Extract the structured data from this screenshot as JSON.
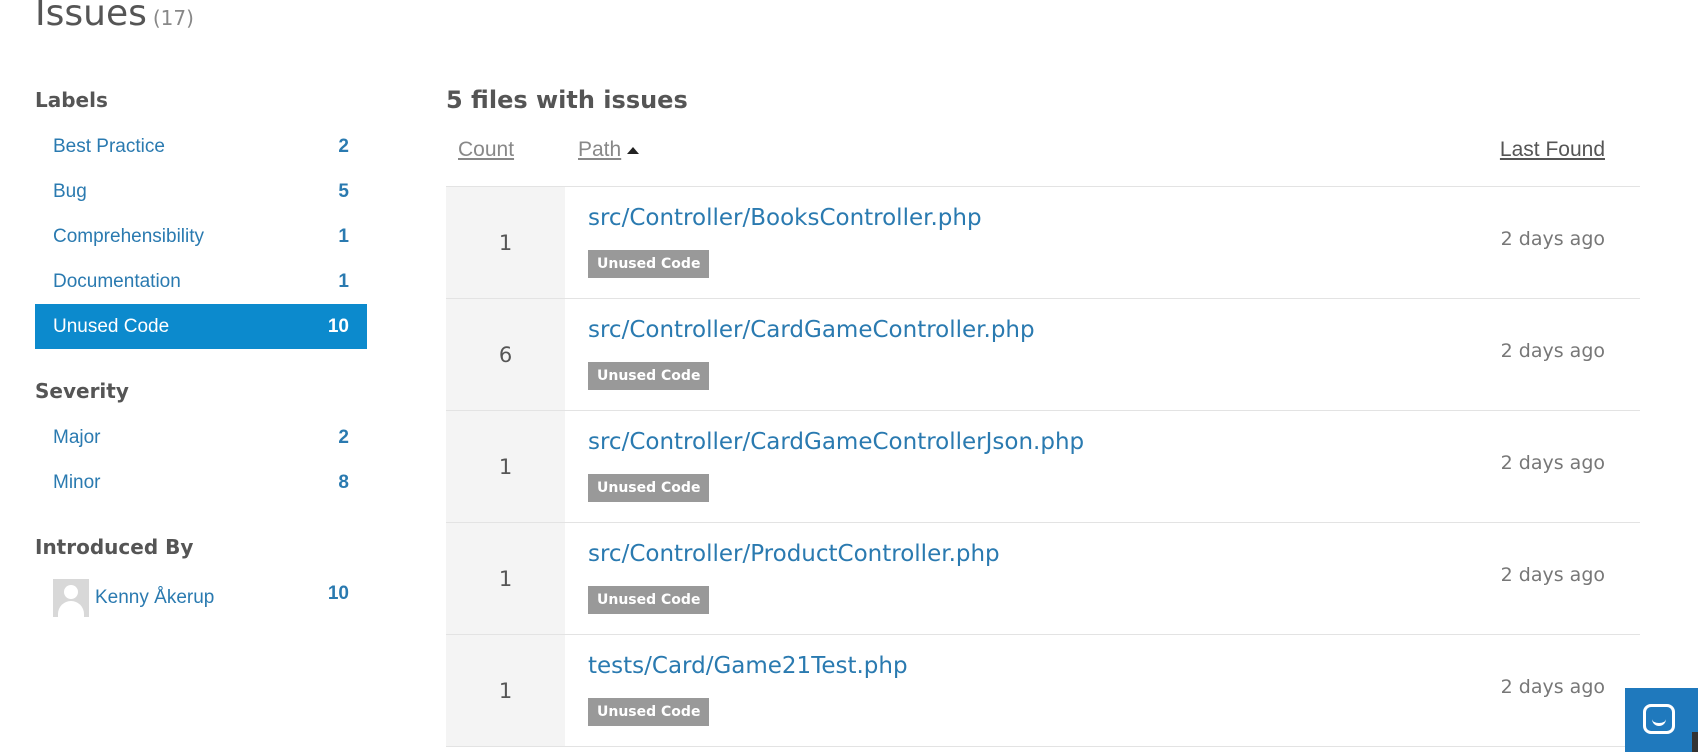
{
  "header": {
    "title": "Issues",
    "count": "(17)"
  },
  "sidebar": {
    "labels_title": "Labels",
    "labels": [
      {
        "name": "Best Practice",
        "count": "2"
      },
      {
        "name": "Bug",
        "count": "5"
      },
      {
        "name": "Comprehensibility",
        "count": "1"
      },
      {
        "name": "Documentation",
        "count": "1"
      },
      {
        "name": "Unused Code",
        "count": "10",
        "active": true
      }
    ],
    "severity_title": "Severity",
    "severity": [
      {
        "name": "Major",
        "count": "2"
      },
      {
        "name": "Minor",
        "count": "8"
      }
    ],
    "introduced_title": "Introduced By",
    "introduced": [
      {
        "name": "Kenny Åkerup",
        "count": "10"
      }
    ]
  },
  "main": {
    "files_title": "5 files with issues",
    "columns": {
      "count": "Count",
      "path": "Path",
      "last_found": "Last Found"
    },
    "rows": [
      {
        "count": "1",
        "path": "src/Controller/BooksController.php",
        "badge": "Unused Code",
        "found": "2 days ago"
      },
      {
        "count": "6",
        "path": "src/Controller/CardGameController.php",
        "badge": "Unused Code",
        "found": "2 days ago"
      },
      {
        "count": "1",
        "path": "src/Controller/CardGameControllerJson.php",
        "badge": "Unused Code",
        "found": "2 days ago"
      },
      {
        "count": "1",
        "path": "src/Controller/ProductController.php",
        "badge": "Unused Code",
        "found": "2 days ago"
      },
      {
        "count": "1",
        "path": "tests/Card/Game21Test.php",
        "badge": "Unused Code",
        "found": "2 days ago"
      }
    ]
  },
  "colors": {
    "accent": "#0c8acd",
    "link": "#2a7ab0",
    "badge": "#999999",
    "chat": "#1f79bd"
  },
  "icons": {
    "sort": "sort-asc-icon",
    "avatar": "user-avatar-icon",
    "chat": "chat-icon"
  }
}
